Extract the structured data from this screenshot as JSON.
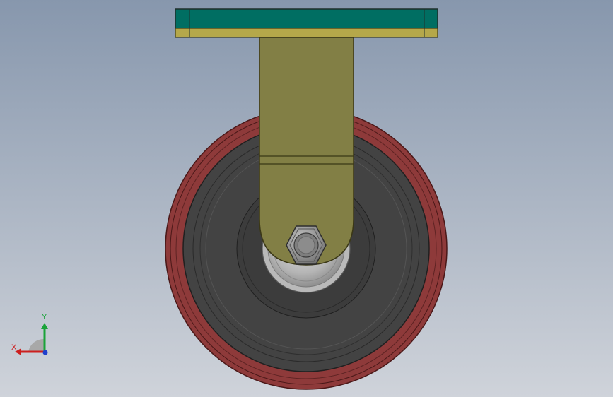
{
  "background": {
    "top_color": "#8797ad",
    "bottom_color": "#cfd3da"
  },
  "model": {
    "mounting_plate": {
      "name": "mounting-plate",
      "color": "#006e62",
      "edge_color": "#b5a84a"
    },
    "fork": {
      "name": "fork",
      "color": "#827f45",
      "edge_color": "#3a3716"
    },
    "tread": {
      "name": "tread",
      "color": "#8e3a3a"
    },
    "wheel_core": {
      "name": "wheel-core",
      "color": "#434343"
    },
    "axle_nut": {
      "name": "axle-nut",
      "color": "#8a8a8a"
    }
  },
  "triad": {
    "y_label": "Y",
    "x_label": "X",
    "y_color": "#1aa339",
    "x_color": "#cc1f1f",
    "z_color": "#1f3fcc"
  }
}
